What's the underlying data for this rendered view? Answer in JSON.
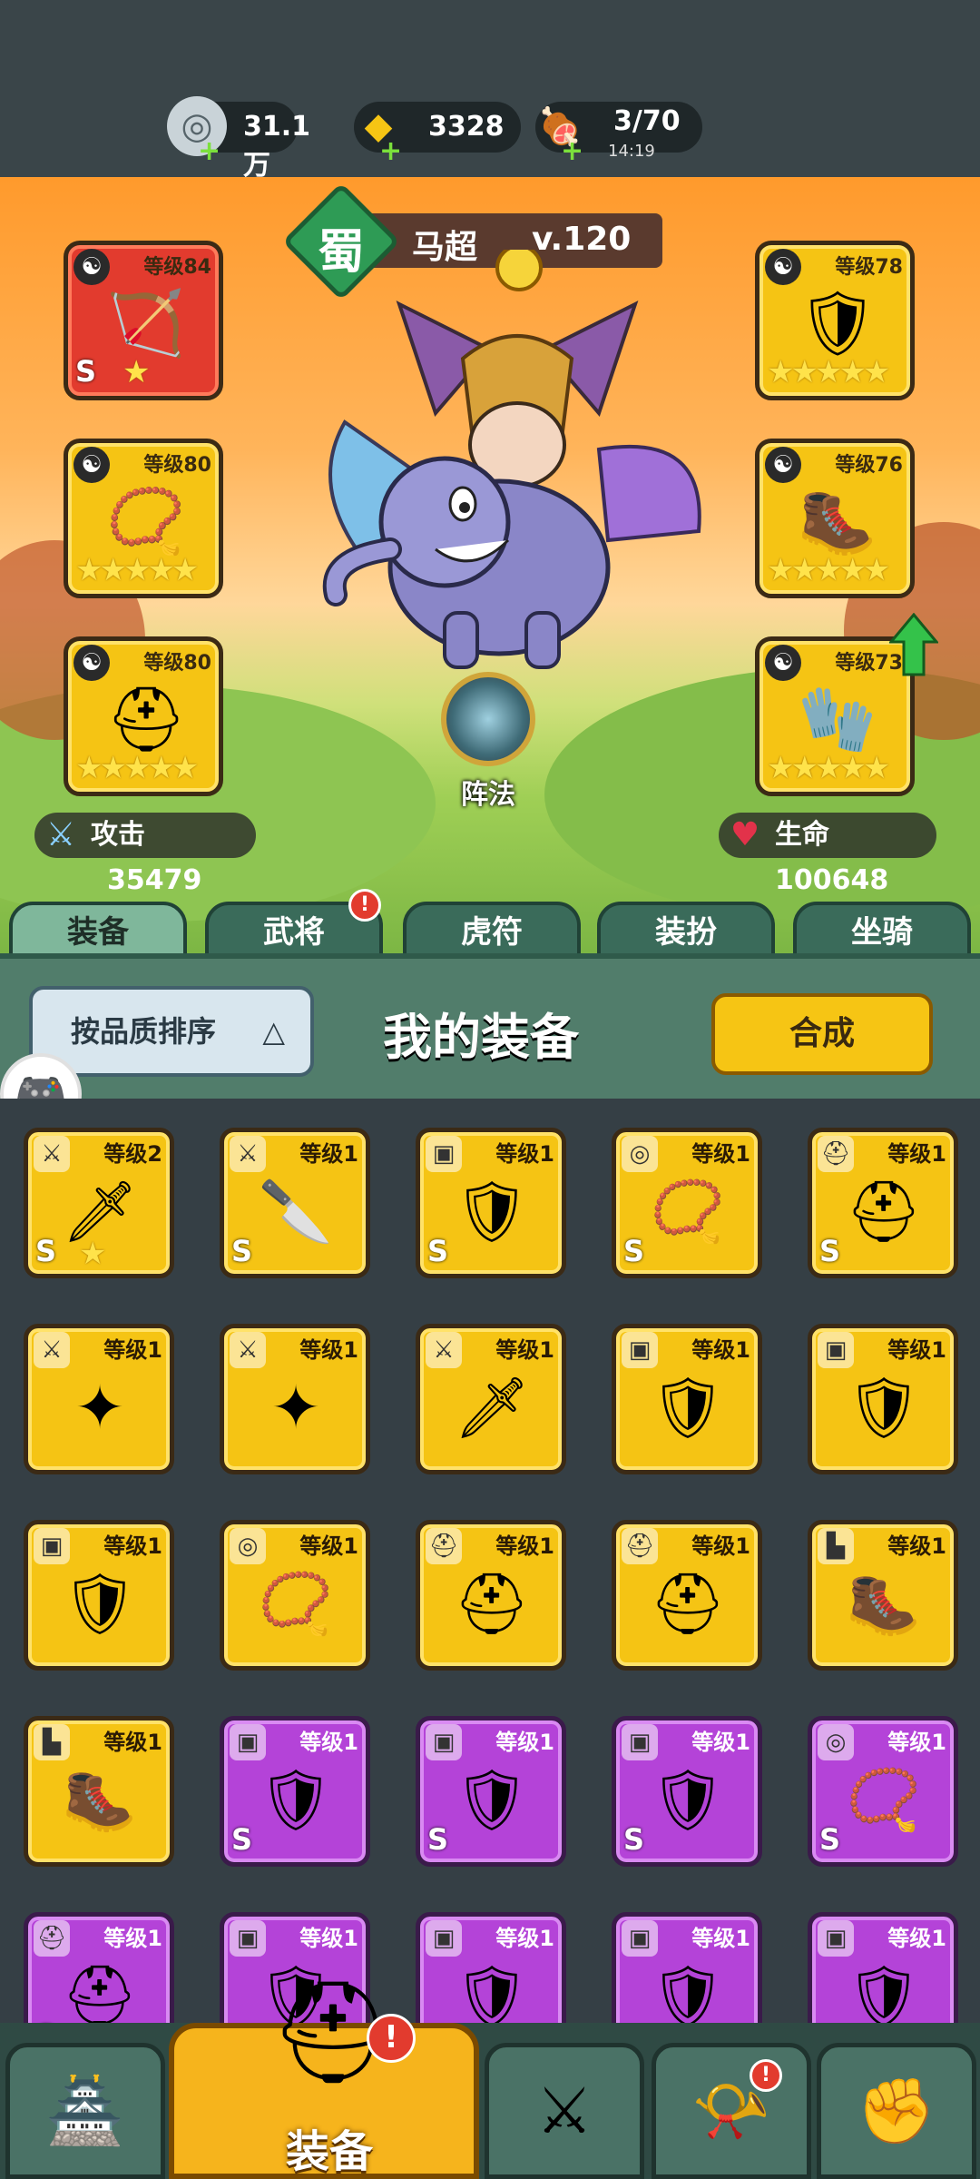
{
  "resources": [
    {
      "name": "silver-coin",
      "icon": "coin-icon",
      "value": "31.1万"
    },
    {
      "name": "gold-ingot",
      "icon": "gold-ingot-icon",
      "value": "3328"
    },
    {
      "name": "stamina",
      "icon": "meat-icon",
      "value": "3/70",
      "sub": "14:19"
    }
  ],
  "hero": {
    "kingdom": "蜀",
    "name": "马超",
    "level": "v.120",
    "attack_label": "攻击",
    "attack_value": "35479",
    "life_label": "生命",
    "life_value": "100648",
    "formation_label": "阵法"
  },
  "equipped": {
    "left": [
      {
        "level": "等级84",
        "stars": 1,
        "rarity": "red",
        "icon": "crossbow-icon"
      },
      {
        "level": "等级80",
        "stars": 5,
        "rarity": "gold",
        "icon": "amulet-icon"
      },
      {
        "level": "等级80",
        "stars": 5,
        "rarity": "gold",
        "icon": "helmet-icon"
      }
    ],
    "right": [
      {
        "level": "等级78",
        "stars": 5,
        "rarity": "gold",
        "icon": "armor-icon"
      },
      {
        "level": "等级76",
        "stars": 5,
        "rarity": "gold",
        "icon": "boots-icon"
      },
      {
        "level": "等级73",
        "stars": 5,
        "rarity": "gold",
        "icon": "gauntlet-icon"
      }
    ]
  },
  "tabs": [
    {
      "label": "装备",
      "active": true
    },
    {
      "label": "武将",
      "badge": "!"
    },
    {
      "label": "虎符"
    },
    {
      "label": "装扮"
    },
    {
      "label": "坐骑"
    }
  ],
  "panel": {
    "sort_label": "按品质排序",
    "title": "我的装备",
    "merge_label": "合成"
  },
  "inventory": [
    {
      "level": "等级2",
      "rarity": "gold",
      "type": "weapon",
      "icon": "lightning-sword-icon",
      "s": true,
      "star": true
    },
    {
      "level": "等级1",
      "rarity": "gold",
      "type": "weapon",
      "icon": "dagger-icon",
      "s": true
    },
    {
      "level": "等级1",
      "rarity": "gold",
      "type": "armor",
      "icon": "armor-icon",
      "s": true
    },
    {
      "level": "等级1",
      "rarity": "gold",
      "type": "amulet",
      "icon": "amulet-icon",
      "s": true
    },
    {
      "level": "等级1",
      "rarity": "gold",
      "type": "helmet",
      "icon": "helmet-icon",
      "s": true
    },
    {
      "level": "等级1",
      "rarity": "gold",
      "type": "weapon",
      "icon": "shuriken-icon"
    },
    {
      "level": "等级1",
      "rarity": "gold",
      "type": "weapon",
      "icon": "shuriken-icon"
    },
    {
      "level": "等级1",
      "rarity": "gold",
      "type": "weapon",
      "icon": "blade-icon"
    },
    {
      "level": "等级1",
      "rarity": "gold",
      "type": "armor",
      "icon": "armor-icon"
    },
    {
      "level": "等级1",
      "rarity": "gold",
      "type": "armor",
      "icon": "armor-icon"
    },
    {
      "level": "等级1",
      "rarity": "gold",
      "type": "armor",
      "icon": "armor-icon"
    },
    {
      "level": "等级1",
      "rarity": "gold",
      "type": "amulet",
      "icon": "amulet-icon"
    },
    {
      "level": "等级1",
      "rarity": "gold",
      "type": "helmet",
      "icon": "helmet-icon"
    },
    {
      "level": "等级1",
      "rarity": "gold",
      "type": "helmet",
      "icon": "helmet-icon"
    },
    {
      "level": "等级1",
      "rarity": "gold",
      "type": "boots",
      "icon": "boots-icon"
    },
    {
      "level": "等级1",
      "rarity": "gold",
      "type": "boots",
      "icon": "boots-icon"
    },
    {
      "level": "等级1",
      "rarity": "purple",
      "type": "armor",
      "icon": "armor-icon",
      "s": true
    },
    {
      "level": "等级1",
      "rarity": "purple",
      "type": "armor",
      "icon": "armor-icon",
      "s": true
    },
    {
      "level": "等级1",
      "rarity": "purple",
      "type": "armor",
      "icon": "armor-icon",
      "s": true
    },
    {
      "level": "等级1",
      "rarity": "purple",
      "type": "amulet",
      "icon": "amulet-icon",
      "s": true
    },
    {
      "level": "等级1",
      "rarity": "purple",
      "type": "helmet",
      "icon": "helmet-icon",
      "s": true
    },
    {
      "level": "等级1",
      "rarity": "purple",
      "type": "armor",
      "icon": "armor-icon"
    },
    {
      "level": "等级1",
      "rarity": "purple",
      "type": "armor",
      "icon": "armor-icon"
    },
    {
      "level": "等级1",
      "rarity": "purple",
      "type": "armor",
      "icon": "armor-icon"
    },
    {
      "level": "等级1",
      "rarity": "purple",
      "type": "armor",
      "icon": "armor-icon"
    }
  ],
  "nav": [
    {
      "name": "nav-castle",
      "icon": "castle-icon"
    },
    {
      "name": "nav-equipment",
      "label": "装备",
      "icon": "helmet-icon",
      "badge": "!"
    },
    {
      "name": "nav-battle",
      "icon": "crossed-swords-icon"
    },
    {
      "name": "nav-recruit",
      "icon": "horn-icon",
      "badge": "!"
    },
    {
      "name": "nav-upgrade",
      "icon": "fist-up-icon"
    }
  ],
  "colors": {
    "gold": "#f5c414",
    "purple": "#b443d8",
    "red": "#e23b2e",
    "accent": "#f6c514"
  }
}
